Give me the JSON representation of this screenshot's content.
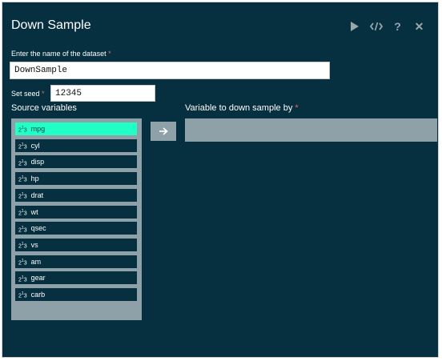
{
  "dialog": {
    "title": "Down Sample",
    "toolbar": [
      {
        "name": "run-icon"
      },
      {
        "name": "code-icon"
      },
      {
        "name": "help-icon"
      },
      {
        "name": "close-icon"
      }
    ]
  },
  "dataset": {
    "label": "Enter the name of the dataset",
    "required_mark": "*",
    "value": "DownSample"
  },
  "seed": {
    "label": "Set seed",
    "required_mark": "*",
    "value": "12345"
  },
  "source": {
    "title": "Source variables",
    "icon_text": "2",
    "icon_sup": "1",
    "icon_tail": "3",
    "items": [
      {
        "label": "mpg",
        "selected": true
      },
      {
        "label": "cyl"
      },
      {
        "label": "disp"
      },
      {
        "label": "hp"
      },
      {
        "label": "drat"
      },
      {
        "label": "wt"
      },
      {
        "label": "qsec"
      },
      {
        "label": "vs"
      },
      {
        "label": "am"
      },
      {
        "label": "gear"
      },
      {
        "label": "carb"
      }
    ]
  },
  "target": {
    "title": "Variable to down sample by",
    "required_mark": "*"
  },
  "colors": {
    "background": "#062f3f",
    "selected": "#1fffc6",
    "panel": "#8fa1a8",
    "required": "#e06a6a"
  }
}
